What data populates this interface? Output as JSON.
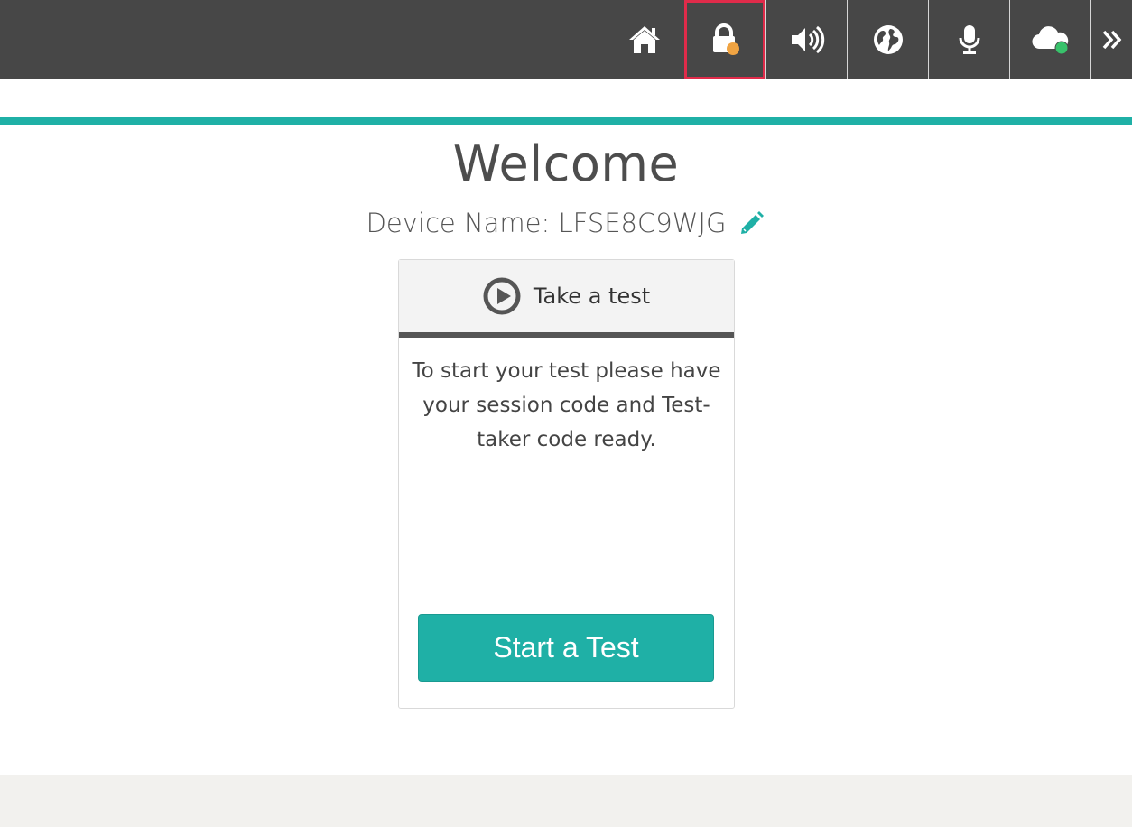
{
  "toolbar": {
    "items": [
      {
        "name": "home-icon"
      },
      {
        "name": "lock-icon",
        "status_color": "#f0a443",
        "selected": true
      },
      {
        "name": "volume-icon"
      },
      {
        "name": "globe-icon"
      },
      {
        "name": "microphone-icon"
      },
      {
        "name": "cloud-icon",
        "status_color": "#38c26b"
      },
      {
        "name": "double-chevron-right-icon"
      }
    ]
  },
  "main": {
    "title": "Welcome",
    "device_label": "Device Name: LFSE8C9WJG",
    "edit_icon": "pencil-icon"
  },
  "card": {
    "title": "Take a test",
    "title_icon": "play-circle-icon",
    "body": "To start your test please have your session code and Test-taker code ready.",
    "button_label": "Start a Test"
  },
  "colors": {
    "accent": "#1fb0a6",
    "toolbar_bg": "#474747",
    "selected_border": "#e02b4a",
    "lock_status": "#f0a443",
    "cloud_status": "#38c26b"
  }
}
